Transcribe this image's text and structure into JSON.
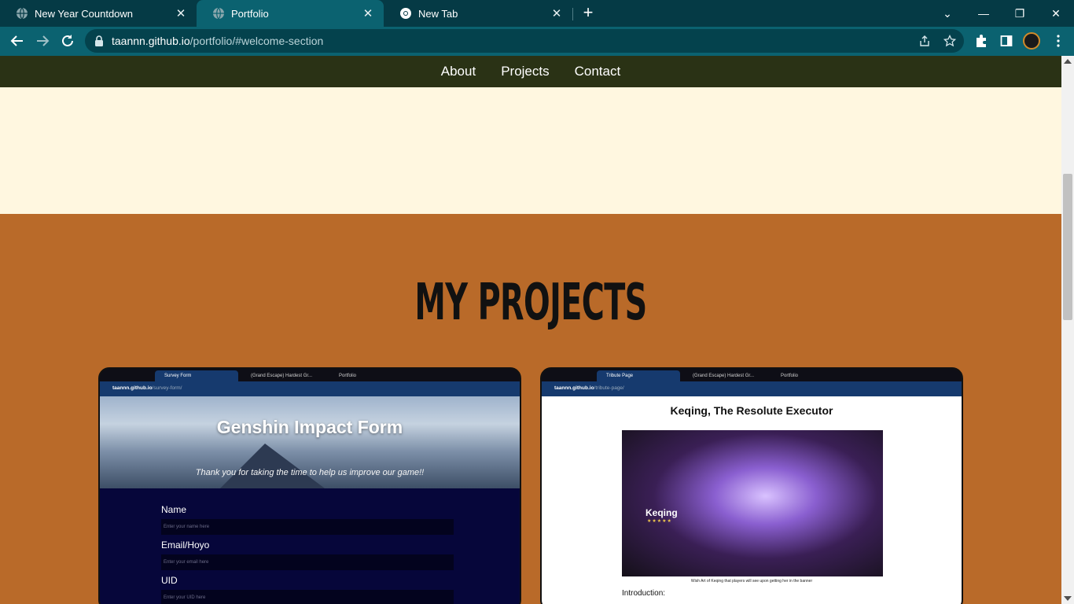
{
  "browser": {
    "tabs": [
      {
        "title": "New Year Countdown",
        "icon": "globe-icon",
        "active": false
      },
      {
        "title": "Portfolio",
        "icon": "globe-icon",
        "active": true
      },
      {
        "title": "New Tab",
        "icon": "chrome-icon",
        "active": false
      }
    ],
    "new_tab_symbol": "+",
    "window_controls": {
      "dropdown": "⌄",
      "minimize": "—",
      "maximize": "❐",
      "close": "✕"
    },
    "url_host": "taannn.github.io",
    "url_path": "/portfolio/#welcome-section"
  },
  "site": {
    "nav": [
      {
        "label": "About"
      },
      {
        "label": "Projects"
      },
      {
        "label": "Contact"
      }
    ],
    "projects_heading": "My projects",
    "cards": [
      {
        "mini_tabs": [
          "Survey Form",
          "(Grand Escape) Hardest Gr...",
          "Portfolio"
        ],
        "mini_url_host": "taannn.github.io",
        "mini_url_path": "/survey-form/",
        "hero_title": "Genshin Impact Form",
        "hero_subtitle": "Thank you for taking the time to help us improve our game!!",
        "fields": [
          {
            "label": "Name",
            "placeholder": "Enter your name here"
          },
          {
            "label": "Email/Hoyo",
            "placeholder": "Enter your email here"
          },
          {
            "label": "UID",
            "placeholder": "Enter your UID here"
          }
        ]
      },
      {
        "mini_tabs": [
          "Tribute Page",
          "(Grand Escape) Hardest Gr...",
          "Portfolio"
        ],
        "mini_url_host": "taannn.github.io",
        "mini_url_path": "/tribute-page/",
        "title": "Keqing, The Resolute Executor",
        "image_name": "Keqing",
        "image_stars": "★★★★★",
        "caption": "Wish Art of Keqing that players will see upon getting her in the banner",
        "intro_label": "Introduction:"
      }
    ]
  }
}
